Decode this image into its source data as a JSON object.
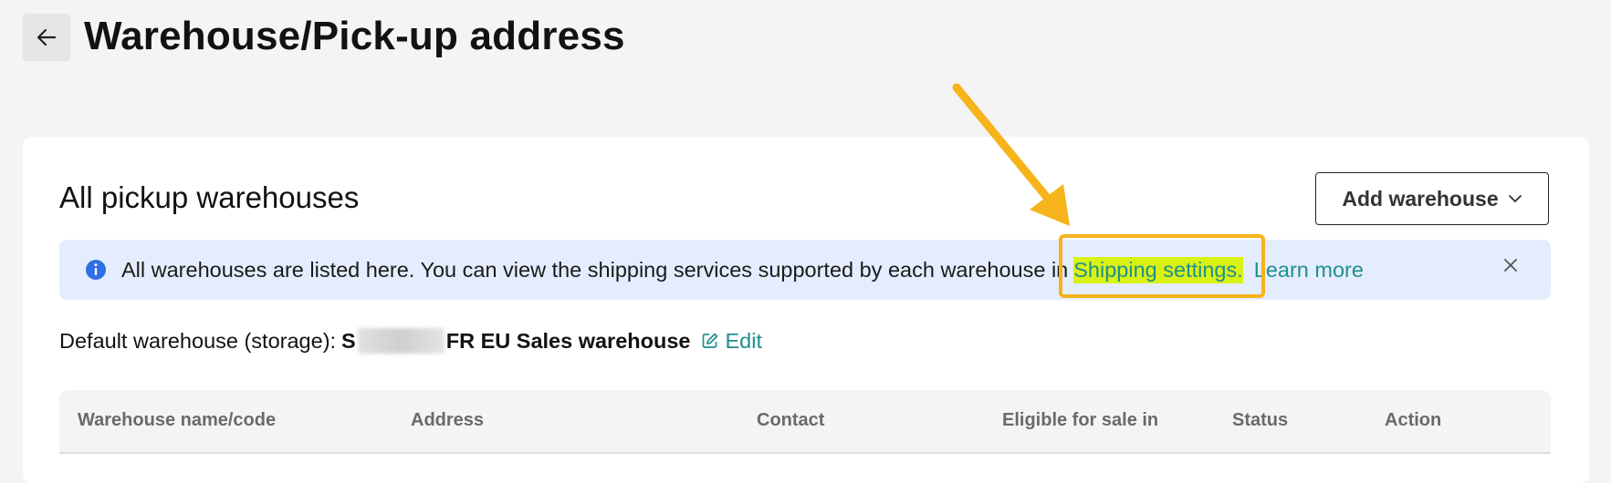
{
  "header": {
    "title": "Warehouse/Pick-up address"
  },
  "card": {
    "title": "All pickup warehouses",
    "add_button": "Add warehouse",
    "banner": {
      "text_before": "All warehouses are listed here. You can view the shipping services supported by each warehouse in",
      "shipping_link": "Shipping settings.",
      "learn_more": "Learn more"
    },
    "default_label": "Default warehouse (storage):",
    "default_prefix": "S",
    "default_suffix": "FR EU Sales warehouse",
    "edit_label": "Edit",
    "columns": [
      "Warehouse name/code",
      "Address",
      "Contact",
      "Eligible for sale in",
      "Status",
      "Action"
    ]
  },
  "colors": {
    "accent": "#1f8f8f",
    "highlight": "#d8f214",
    "annotation": "#f6b31b",
    "banner_bg": "#e4edfd"
  }
}
